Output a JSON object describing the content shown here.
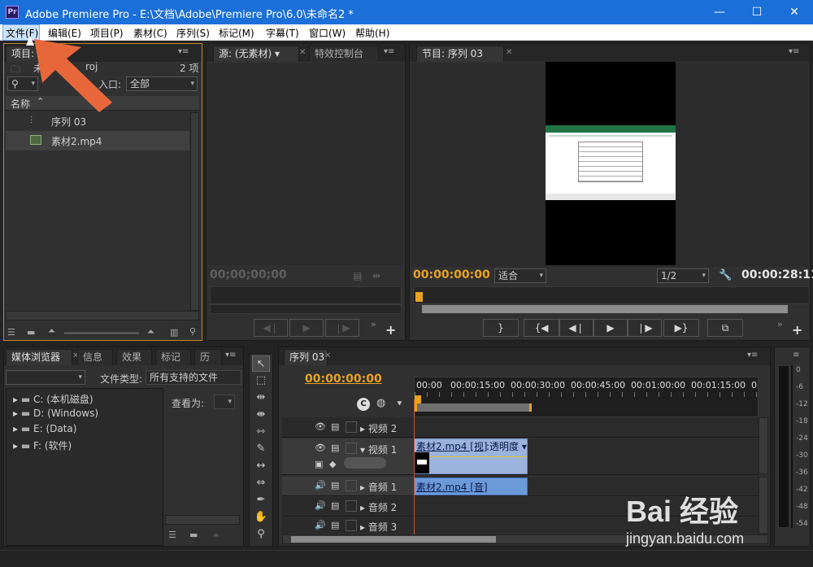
{
  "window": {
    "app_icon": "Pr",
    "title": "Adobe Premiere Pro - E:\\文档\\Adobe\\Premiere Pro\\6.0\\未命名2 *",
    "minimize": "—",
    "maximize": "☐",
    "close": "✕"
  },
  "menu": [
    "文件(F)",
    "编辑(E)",
    "项目(P)",
    "素材(C)",
    "序列(S)",
    "标记(M)",
    "字幕(T)",
    "窗口(W)",
    "帮助(H)"
  ],
  "project": {
    "tab": "项目: 未",
    "file_name_partial": "未",
    "file_ext_partial": "roj",
    "item_count": "2 项",
    "in_label": "入口:",
    "in_value": "全部",
    "col_name": "名称",
    "items": [
      {
        "name": "序列 03",
        "icon": "sequence-icon"
      },
      {
        "name": "素材2.mp4",
        "icon": "video-clip-icon"
      }
    ]
  },
  "source": {
    "tab": "源: (无素材)",
    "effect_tab": "特效控制台",
    "timecode": "00;00;00;00"
  },
  "program": {
    "tab": "节目: 序列 03",
    "timecode": "00:00:00:00",
    "fit": "适合",
    "ratio": "1/2",
    "duration": "00:00:28:11"
  },
  "media": {
    "tabs": [
      "媒体浏览器",
      "信息",
      "效果",
      "标记",
      "历"
    ],
    "file_type_label": "文件类型:",
    "file_type_value": "所有支持的文件",
    "view_as_label": "查看为:",
    "drives": [
      "C: (本机磁盘)",
      "D: (Windows)",
      "E: (Data)",
      "F: (软件)"
    ]
  },
  "timeline": {
    "tab": "序列 03",
    "timecode": "00:00:00:00",
    "ruler": [
      "00:00",
      "00:00:15:00",
      "00:00:30:00",
      "00:00:45:00",
      "00:01:00:00",
      "00:01:15:00",
      "0"
    ],
    "tracks": {
      "video2": "视频 2",
      "video1": "视频 1",
      "audio1": "音频 1",
      "audio2": "音频 2",
      "audio3": "音频 3"
    },
    "clip_video": "素材2.mp4 [视]",
    "clip_opacity": ":透明度",
    "clip_audio": "素材2.mp4 [音]"
  },
  "audio_meter": {
    "scale": [
      "0",
      "-6",
      "-12",
      "-18",
      "-24",
      "-30",
      "-36",
      "-42",
      "-48",
      "-54"
    ]
  },
  "watermark": {
    "brand": "Bai 经验",
    "url": "jingyan.baidu.com"
  }
}
